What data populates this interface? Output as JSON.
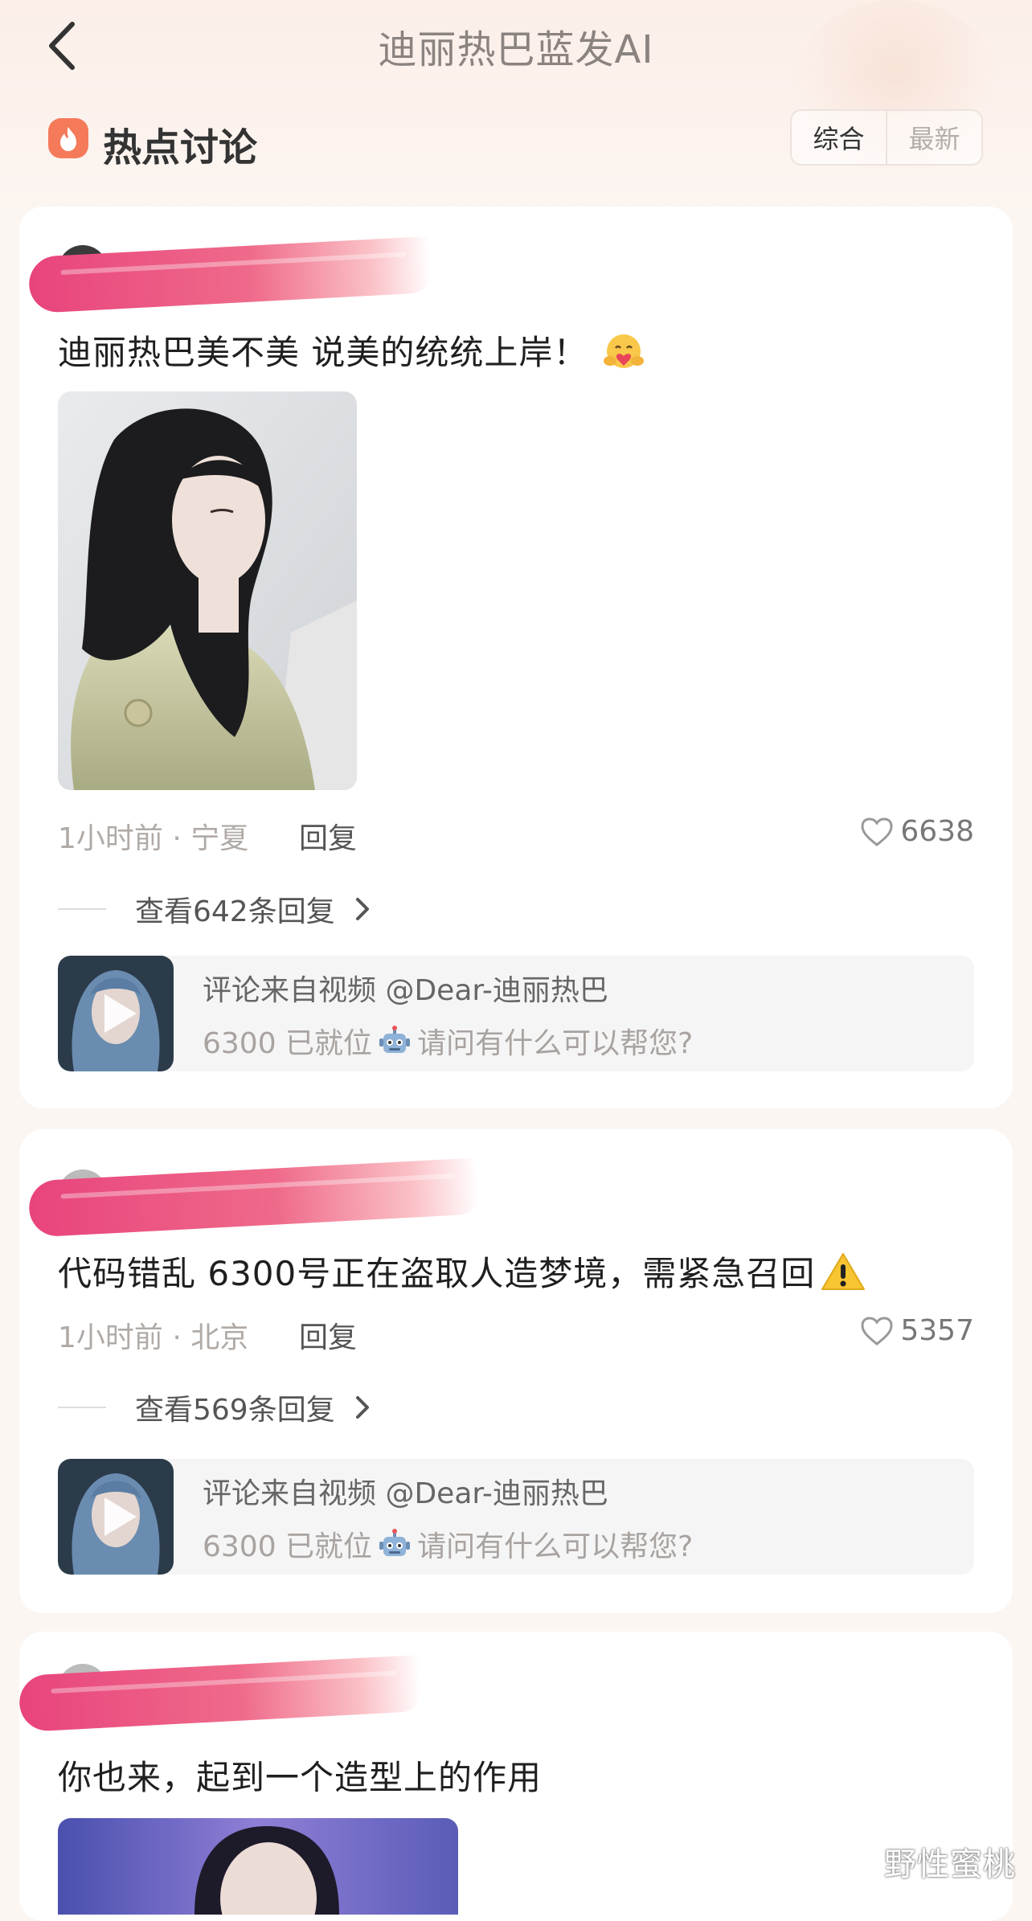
{
  "header": {
    "title": "迪丽热巴蓝发AI",
    "back_icon": "chevron-left-icon"
  },
  "section": {
    "title": "热点讨论",
    "icon": "flame-icon",
    "sort_options": [
      "综合",
      "最新"
    ],
    "active_sort": "综合"
  },
  "comments": [
    {
      "username_redacted": true,
      "text": "迪丽热巴美不美 说美的统统上岸！",
      "emoji": "hugging-face-emoji",
      "has_photo": true,
      "time_location": "1小时前 · 宁夏",
      "reply_label": "回复",
      "likes": "6638",
      "view_replies": "查看642条回复",
      "source_line1": "评论来自视频 @Dear-迪丽热巴",
      "source_line2_pre": "6300 已就位",
      "source_line2_post": "请问有什么可以帮您?"
    },
    {
      "username_redacted": true,
      "text": "代码错乱 6300号正在盗取人造梦境，需紧急召回",
      "emoji": "warning-emoji",
      "has_photo": false,
      "time_location": "1小时前 · 北京",
      "reply_label": "回复",
      "likes": "5357",
      "view_replies": "查看569条回复",
      "source_line1": "评论来自视频 @Dear-迪丽热巴",
      "source_line2_pre": "6300 已就位",
      "source_line2_post": "请问有什么可以帮您?"
    },
    {
      "username_redacted": true,
      "text": "你也来，起到一个造型上的作用",
      "has_photo": true
    }
  ],
  "watermark": "野性蜜桃",
  "colors": {
    "redact": "#e8447c",
    "hot_icon": "#f47a5a",
    "accent_text": "#555555"
  }
}
